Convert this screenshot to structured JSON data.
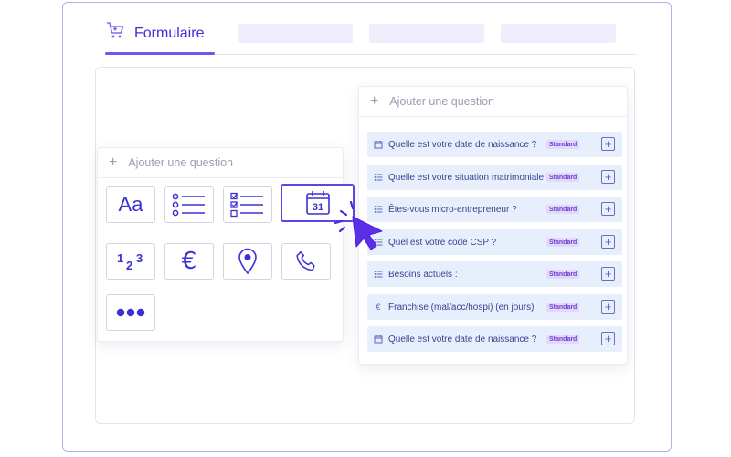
{
  "tabs": {
    "active_label": "Formulaire"
  },
  "left_card": {
    "add_question": "Ajouter une question",
    "text_tile_label": "Aa",
    "calendar_day": "31"
  },
  "right_card": {
    "add_question": "Ajouter une question",
    "questions": [
      {
        "icon": "calendar-icon",
        "text": "Quelle est votre date de naissance ?",
        "badge": "Standard"
      },
      {
        "icon": "list-icon",
        "text": "Quelle est votre situation matrimoniale ?",
        "badge": "Standard"
      },
      {
        "icon": "list-icon",
        "text": "Êtes-vous micro-entrepreneur ?",
        "badge": "Standard"
      },
      {
        "icon": "list-icon",
        "text": "Quel est votre code CSP ?",
        "badge": "Standard"
      },
      {
        "icon": "list-icon",
        "text": "Besoins actuels :",
        "badge": "Standard"
      },
      {
        "icon": "euro-icon",
        "text": "Franchise (mal/acc/hospi) (en jours)",
        "badge": "Standard"
      },
      {
        "icon": "calendar-icon",
        "text": "Quelle est votre date de naissance ?",
        "badge": "Standard"
      }
    ]
  },
  "colors": {
    "accent": "#5b45e8",
    "accent_dark": "#3d2fd6",
    "row_bg": "#e8effc",
    "badge_bg": "#e3d8fb",
    "frame_border": "#b7aef0"
  }
}
